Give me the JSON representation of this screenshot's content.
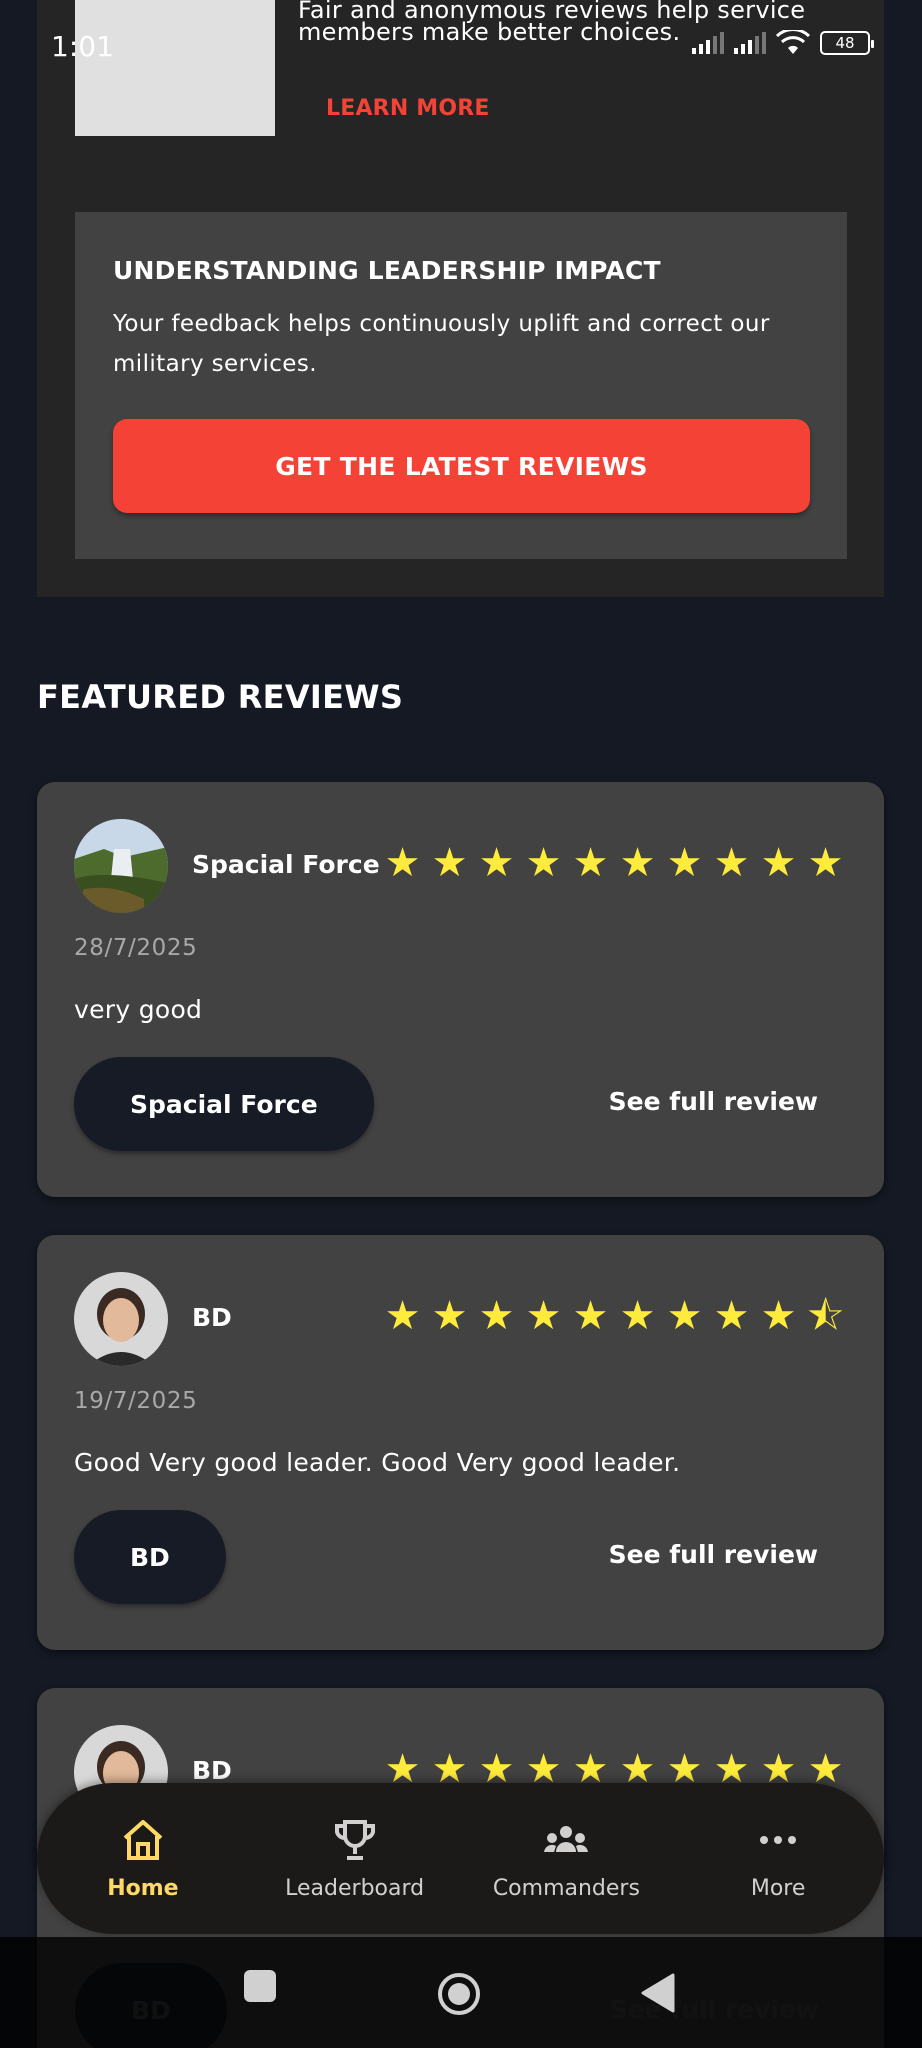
{
  "status_bar": {
    "time": "1:01",
    "battery": "48"
  },
  "promo": {
    "text_line_clipped": "Fair and anonymous reviews help service",
    "text_line": "members make better choices.",
    "learn_more": "LEARN MORE"
  },
  "impact": {
    "title": "UNDERSTANDING LEADERSHIP IMPACT",
    "body": "Your feedback helps continuously uplift and correct our military services.",
    "button": "GET THE LATEST REVIEWS"
  },
  "featured": {
    "title": "FEATURED REVIEWS",
    "see_full_label": "See full review",
    "reviews": [
      {
        "author": "Spacial Force",
        "rating": 10,
        "max_rating": 10,
        "date": "28/7/2025",
        "text": "very good",
        "chip": "Spacial Force",
        "avatar_icon": "waterfall-photo"
      },
      {
        "author": "BD",
        "rating": 9.5,
        "max_rating": 10,
        "date": "19/7/2025",
        "text": "Good Very good leader. Good Very good leader.",
        "chip": "BD",
        "avatar_icon": "person-photo"
      },
      {
        "author": "BD",
        "rating": 10,
        "max_rating": 10,
        "chip": "BD",
        "avatar_icon": "person-photo"
      }
    ]
  },
  "nav": {
    "items": [
      {
        "label": "Home",
        "icon": "home-icon",
        "active": true
      },
      {
        "label": "Leaderboard",
        "icon": "trophy-icon",
        "active": false
      },
      {
        "label": "Commanders",
        "icon": "group-icon",
        "active": false
      },
      {
        "label": "More",
        "icon": "more-icon",
        "active": false
      }
    ]
  },
  "colors": {
    "accent": "#f44336",
    "star": "#ffeb3b",
    "nav_active": "#ffd966",
    "background": "#141923"
  }
}
